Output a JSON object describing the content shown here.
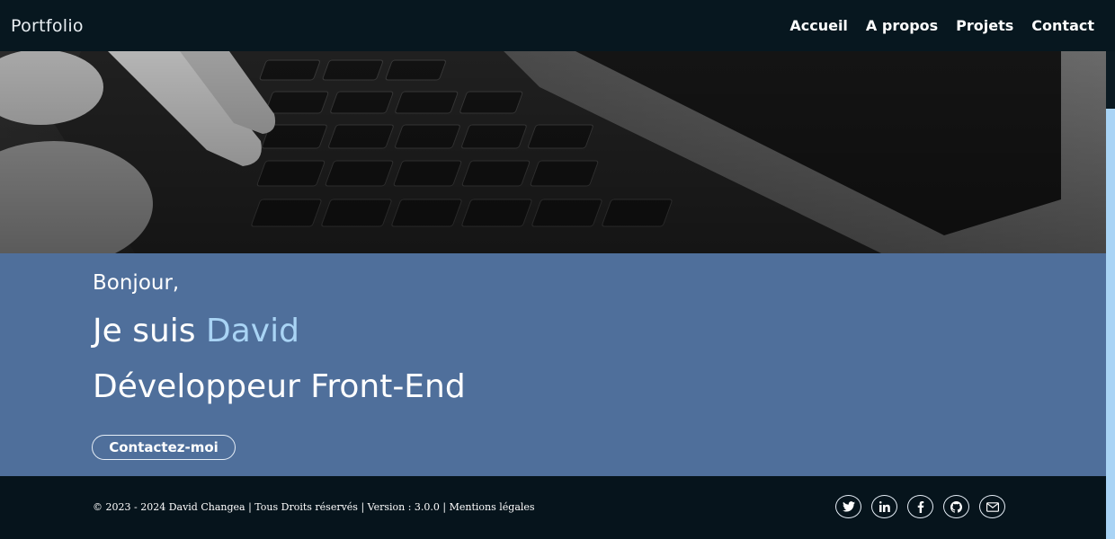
{
  "header": {
    "brand": "Portfolio",
    "nav": [
      "Accueil",
      "A propos",
      "Projets",
      "Contact"
    ]
  },
  "hero": {
    "image": "laptop-keyboard-photo"
  },
  "intro": {
    "greeting": "Bonjour,",
    "prefix": "Je suis ",
    "name": "David",
    "role": "Développeur Front-End",
    "cta": "Contactez-moi"
  },
  "footer": {
    "copyright": "© 2023 - 2024 David Changea | Tous Droits réservés | Version : 3.0.0 | Mentions légales",
    "socials": [
      "twitter-icon",
      "linkedin-icon",
      "facebook-icon",
      "github-icon",
      "mail-icon"
    ]
  },
  "colors": {
    "header_bg": "#07171f",
    "intro_bg": "#4f6f9b",
    "accent": "#a9d4f5",
    "footer_bg": "#06141c"
  }
}
